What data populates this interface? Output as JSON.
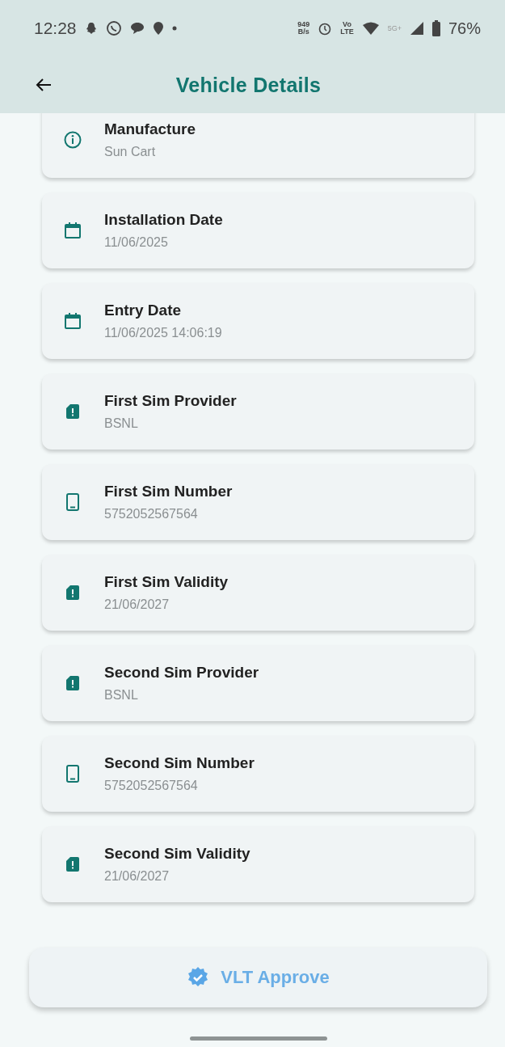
{
  "status_bar": {
    "time": "12:28",
    "net_speed": [
      "949",
      "B/s"
    ],
    "volte": [
      "Vo",
      "LTE"
    ],
    "network": "5G+",
    "battery": "76%"
  },
  "app_bar": {
    "title": "Vehicle Details"
  },
  "details": [
    {
      "kind": "info",
      "label": "Manufacture",
      "value": "Sun Cart"
    },
    {
      "kind": "calendar",
      "label": "Installation Date",
      "value": "11/06/2025"
    },
    {
      "kind": "calendar",
      "label": "Entry Date",
      "value": "11/06/2025 14:06:19"
    },
    {
      "kind": "sim",
      "label": "First Sim Provider",
      "value": "BSNL"
    },
    {
      "kind": "phone",
      "label": "First Sim Number",
      "value": "5752052567564"
    },
    {
      "kind": "sim",
      "label": "First Sim Validity",
      "value": "21/06/2027"
    },
    {
      "kind": "sim",
      "label": "Second Sim Provider",
      "value": "BSNL"
    },
    {
      "kind": "phone",
      "label": "Second Sim Number",
      "value": "5752052567564"
    },
    {
      "kind": "sim",
      "label": "Second Sim Validity",
      "value": "21/06/2027"
    }
  ],
  "action_button": {
    "label": "VLT Approve"
  }
}
